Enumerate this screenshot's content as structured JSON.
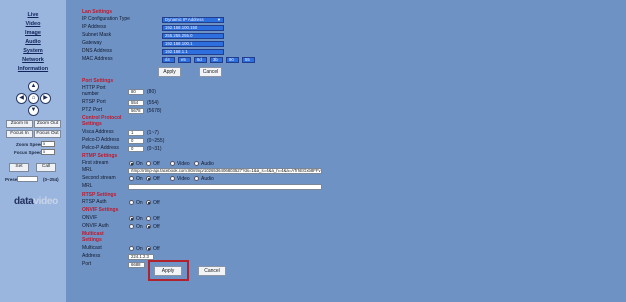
{
  "nav": [
    "Live",
    "Video",
    "Image",
    "Audio",
    "System",
    "Network",
    "Information"
  ],
  "ptz": {
    "up": "▲",
    "down": "▼",
    "left": "◀",
    "right": "▶",
    "home": "⌂",
    "zoom_in": "Zoom In",
    "zoom_out": "Zoom Out",
    "focus_in": "Focus In",
    "focus_out": "Focus Out",
    "zoom_speed_label": "Zoom Speed",
    "zoom_speed_value": "5",
    "focus_speed_label": "Focus Speed",
    "focus_speed_value": "5",
    "set": "Set",
    "call": "Call",
    "preset_label": "Preset",
    "preset_range": "(0~254)"
  },
  "logo": {
    "part1": "data",
    "part2": "video"
  },
  "lan": {
    "title": "Lan Settings",
    "ip_config_label": "IP Configuration Type",
    "ip_config_value": "Dynamic IP Address",
    "ip_label": "IP Address",
    "ip_value": "192.168.100.150",
    "mask_label": "Subnet Mask",
    "mask_value": "255.255.255.0",
    "gateway_label": "Gateway",
    "gateway_value": "192.168.100.1",
    "dns_label": "DNS Address",
    "dns_value": "192.168.1.1",
    "mac_label": "MAC Address",
    "mac": [
      "d4",
      "e5",
      "6d",
      "3b",
      "90",
      "55"
    ],
    "apply": "Apply",
    "cancel": "Cancel"
  },
  "port": {
    "title": "Port Settings",
    "http_label_1": "HTTP Port",
    "http_label_2": "number",
    "http_value": "80",
    "http_default": "(80)",
    "rtsp_label": "RTSP Port",
    "rtsp_value": "554",
    "rtsp_default": "(554)",
    "ptz_label": "PTZ Port",
    "ptz_value": "5678",
    "ptz_default": "(5678)"
  },
  "control": {
    "title_1": "Control Protocol",
    "title_2": "Settings",
    "visca_label": "Visca Address",
    "visca_value": "1",
    "visca_range": "(1~7)",
    "pelcod_label": "Pelco-D Address",
    "pelcod_value": "0",
    "pelcod_range": "(0~255)",
    "pelcop_label": "Pelco-P Address",
    "pelcop_value": "0",
    "pelcop_range": "(0~31)"
  },
  "rtmp": {
    "title": "RTMP Settings",
    "first_label": "First stream",
    "on": "On",
    "off": "Off",
    "video": "Video",
    "audio": "Audio",
    "mrl_label": "MRL",
    "mrl_value": "rtmp://rtmp-api.facebook.com:80/rtmp/1026536406803527?ds=1&a_s=4&a_h=4&a=ATrhEGxb8FFv",
    "second_label": "Second stream",
    "mrl2_label": "MRL",
    "mrl2_value": ""
  },
  "rtsp": {
    "title": "RTSP Settings",
    "auth_label": "RTSP Auth",
    "on": "On",
    "off": "Off"
  },
  "onvif": {
    "title": "ONVIF Settings",
    "onvif_label": "ONVIF",
    "auth_label": "ONVIF Auth",
    "on": "On",
    "off": "Off"
  },
  "multicast": {
    "title_1": "Multicast",
    "title_2": "Settings",
    "multicast_label": "Multicast",
    "on": "On",
    "off": "Off",
    "address_label": "Address",
    "address_value": "224.1.2.3",
    "port_label": "Port",
    "port_value": "6688"
  },
  "footer": {
    "apply": "Apply",
    "cancel": "Cancel"
  }
}
